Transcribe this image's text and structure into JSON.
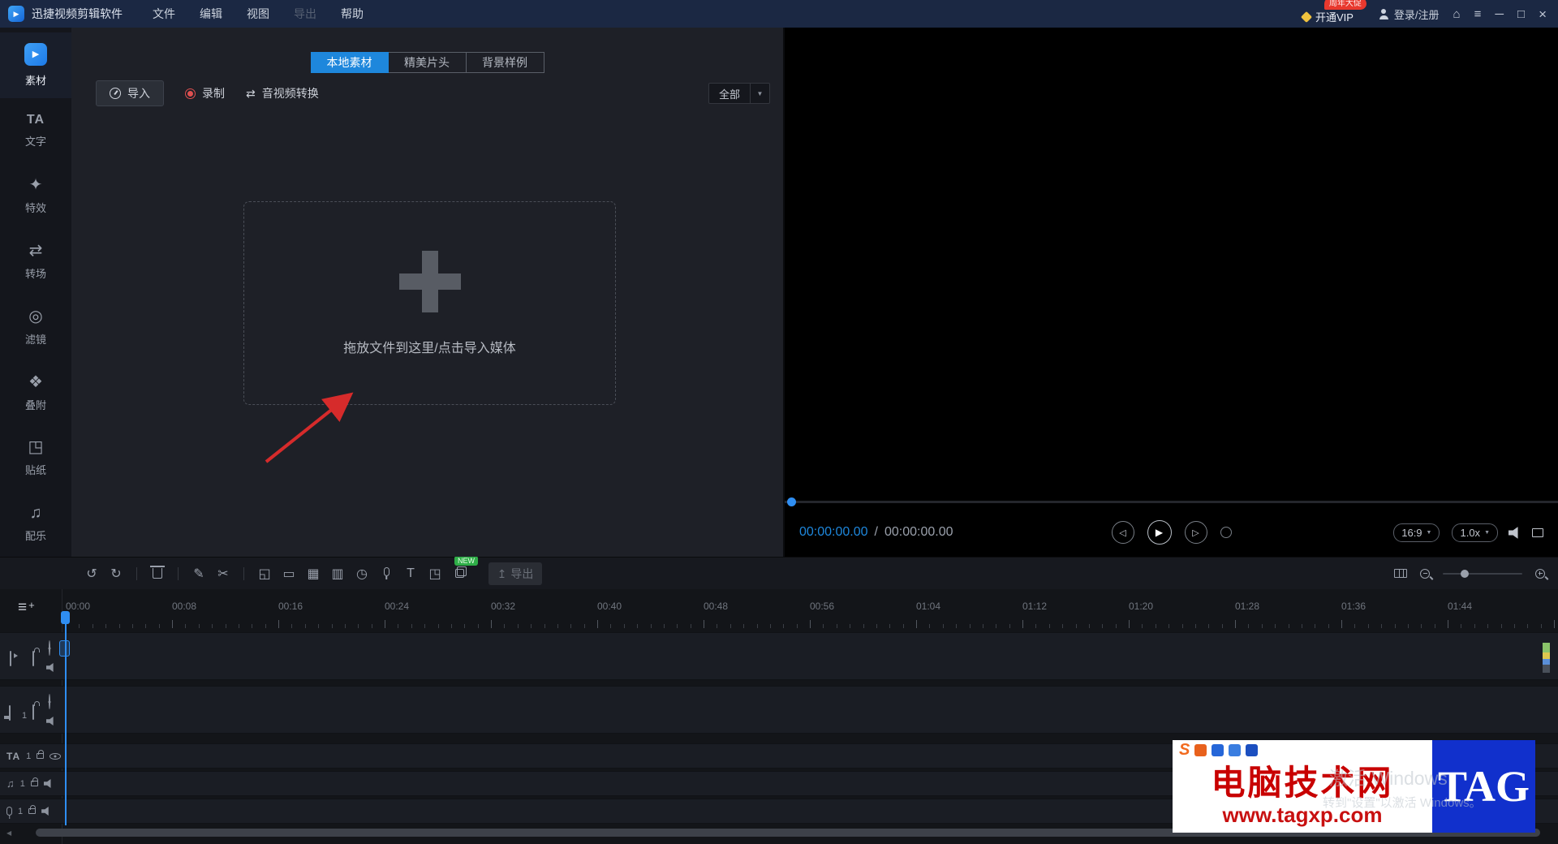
{
  "titlebar": {
    "app_title": "迅捷视频剪辑软件",
    "menus": [
      {
        "label": "文件",
        "enabled": true
      },
      {
        "label": "编辑",
        "enabled": true
      },
      {
        "label": "视图",
        "enabled": true
      },
      {
        "label": "导出",
        "enabled": false
      },
      {
        "label": "帮助",
        "enabled": true
      }
    ],
    "vip_label": "开通VIP",
    "vip_badge": "周年大促",
    "login_label": "登录/注册"
  },
  "glyphs": {
    "logo_play": "▶",
    "home": "⌂",
    "hamburger": "≡",
    "minimize": "─",
    "maximize": "□",
    "close": "×",
    "caret_down": "▼",
    "convert": "⇄",
    "music": "♫",
    "plus": "+",
    "transport_prev": "◁",
    "transport_play": "▶",
    "transport_next": "▷",
    "export_arrow": "↥",
    "scroll_left": "◀"
  },
  "sidebar": {
    "items": [
      {
        "label": "素材",
        "active": true
      },
      {
        "label": "文字",
        "glyph": "TA"
      },
      {
        "label": "特效",
        "glyph": "✦"
      },
      {
        "label": "转场",
        "glyph": "⇄"
      },
      {
        "label": "滤镜",
        "glyph": "◎"
      },
      {
        "label": "叠附",
        "glyph": "❖"
      },
      {
        "label": "贴纸",
        "glyph": "◳"
      },
      {
        "label": "配乐",
        "glyph": "♫"
      }
    ]
  },
  "media_panel": {
    "tabs": [
      {
        "label": "本地素材",
        "active": true
      },
      {
        "label": "精美片头",
        "active": false
      },
      {
        "label": "背景样例",
        "active": false
      }
    ],
    "import_label": "导入",
    "record_label": "录制",
    "convert_label": "音视频转换",
    "filter_value": "全部",
    "dropzone_text": "拖放文件到这里/点击导入媒体"
  },
  "preview": {
    "current_time": "00:00:00.00",
    "separator": "/",
    "duration": "00:00:00.00",
    "aspect_ratio": "16:9",
    "speed": "1.0x"
  },
  "toolbar": {
    "icons": [
      {
        "name": "undo",
        "glyph": "↺"
      },
      {
        "name": "redo",
        "glyph": "↻"
      },
      {
        "divider": true
      },
      {
        "name": "delete",
        "shape": "trash"
      },
      {
        "divider": true
      },
      {
        "name": "edit-clip",
        "glyph": "✎"
      },
      {
        "name": "split",
        "glyph": "✂"
      },
      {
        "divider": true
      },
      {
        "name": "crop",
        "glyph": "◱"
      },
      {
        "name": "subtitle",
        "glyph": "▭"
      },
      {
        "name": "mosaic",
        "glyph": "▦"
      },
      {
        "name": "adjust",
        "glyph": "▥"
      },
      {
        "name": "speed",
        "glyph": "◷"
      },
      {
        "name": "voiceover",
        "shape": "mic"
      },
      {
        "name": "text-tool",
        "glyph": "T"
      },
      {
        "name": "sticker",
        "glyph": "◳"
      },
      {
        "name": "template",
        "shape": "copy",
        "badge": "NEW"
      }
    ],
    "export_label": "导出",
    "new_badge": "NEW"
  },
  "timeline": {
    "ruler_labels": [
      "00:00",
      "00:08",
      "00:16",
      "00:24",
      "00:32",
      "00:40",
      "00:48",
      "00:56",
      "01:04",
      "01:12",
      "01:20",
      "01:28",
      "01:36",
      "01:44"
    ],
    "tracks": [
      {
        "name": "video-track",
        "kind": "video"
      },
      {
        "name": "overlay-track",
        "kind": "pip",
        "index": "1"
      },
      {
        "name": "text-track",
        "kind": "text",
        "icon_label": "TA",
        "index": "1"
      },
      {
        "name": "music-track",
        "kind": "music",
        "index": "1"
      },
      {
        "name": "voice-track",
        "kind": "voice",
        "index": "1"
      }
    ]
  },
  "watermark": {
    "brand_letter": "S",
    "site_name": "电脑技术网",
    "site_url": "www.tagxp.com",
    "logo_text": "TAG"
  },
  "system_watermark": {
    "line1": "激活 Windows",
    "line2": "转到\"设置\"以激活 Windows。"
  },
  "colors": {
    "accent_blue": "#1e87dc",
    "playhead_blue": "#2f8ef2",
    "vip_badge_red": "#e8392e",
    "record_red": "#e05050",
    "new_badge_green": "#2fae48",
    "watermark_red": "#c80000",
    "watermark_blue": "#1130cc"
  }
}
